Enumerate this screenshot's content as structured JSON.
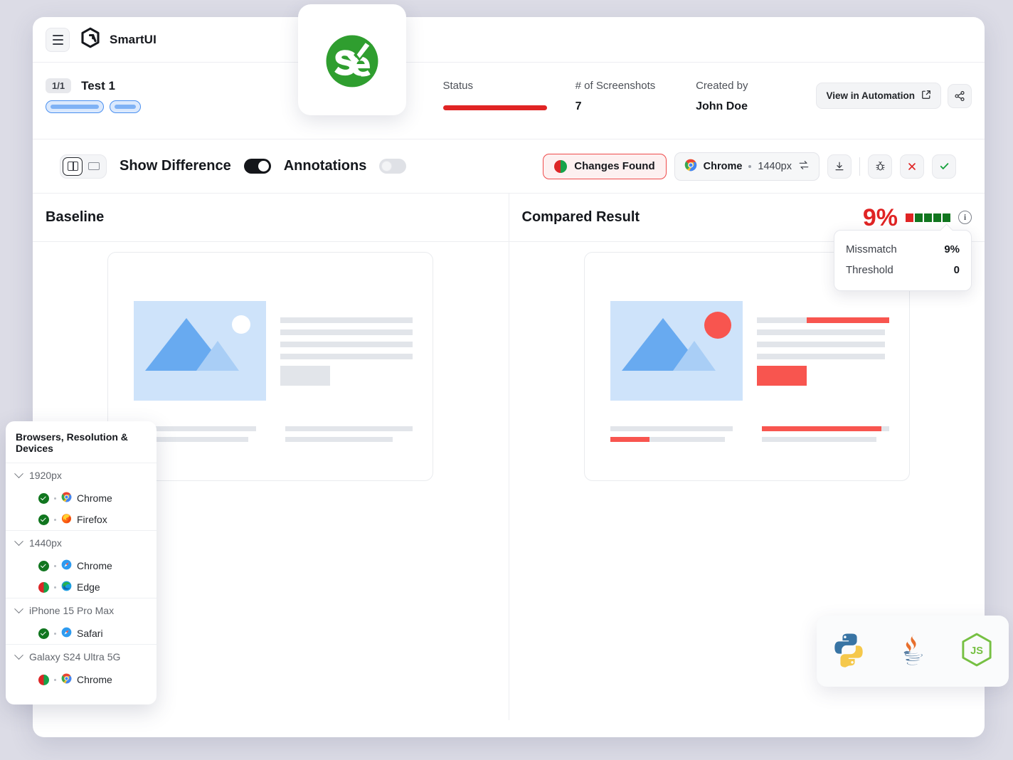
{
  "app": {
    "brand": "SmartUI",
    "menu_icon": "hamburger-icon",
    "logo_icon": "smartui-logo-icon"
  },
  "test": {
    "count_badge": "1/1",
    "title": "Test 1"
  },
  "meta": {
    "status_label": "Status",
    "status_color": "#e02424",
    "screenshots_label": "# of Screenshots",
    "screenshots_value": "7",
    "created_by_label": "Created by",
    "created_by_value": "John Doe",
    "view_automation_label": "View in Automation",
    "share_icon": "share-icon",
    "external-link-icon": "external-link-icon"
  },
  "toolbar": {
    "view_split_icon": "split-view-icon",
    "view_single_icon": "single-view-icon",
    "show_difference_label": "Show Difference",
    "show_difference_on": true,
    "annotations_label": "Annotations",
    "annotations_on": false,
    "changes_found_label": "Changes Found",
    "browser_name": "Chrome",
    "browser_resolution": "1440px",
    "swap_icon": "swap-arrows-icon",
    "download_icon": "download-icon",
    "bug_icon": "bug-icon",
    "reject_icon": "close-x-icon",
    "approve_icon": "check-icon"
  },
  "compare": {
    "baseline_label": "Baseline",
    "result_label": "Compared Result",
    "mismatch_percent": "9%",
    "segments": [
      "red",
      "green",
      "green",
      "green",
      "green"
    ],
    "info_icon": "info-icon",
    "tooltip": {
      "rows": [
        {
          "key": "Missmatch",
          "value": "9%"
        },
        {
          "key": "Threshold",
          "value": "0"
        }
      ]
    }
  },
  "browsers_panel": {
    "title": "Browsers, Resolution & Devices",
    "groups": [
      {
        "name": "1920px",
        "items": [
          {
            "label": "Chrome",
            "status": "pass",
            "browser_icon": "chrome-icon"
          },
          {
            "label": "Firefox",
            "status": "pass",
            "browser_icon": "firefox-icon"
          }
        ]
      },
      {
        "name": "1440px",
        "items": [
          {
            "label": "Chrome",
            "status": "pass",
            "browser_icon": "safari-icon"
          },
          {
            "label": "Edge",
            "status": "fail",
            "browser_icon": "edge-icon"
          }
        ]
      },
      {
        "name": "iPhone 15 Pro Max",
        "items": [
          {
            "label": "Safari",
            "status": "pass",
            "browser_icon": "safari-icon"
          }
        ]
      },
      {
        "name": "Galaxy S24 Ultra 5G",
        "items": [
          {
            "label": "Chrome",
            "status": "fail",
            "browser_icon": "chrome-icon"
          }
        ]
      }
    ]
  },
  "languages": {
    "items": [
      {
        "name": "python-icon"
      },
      {
        "name": "java-icon"
      },
      {
        "name": "nodejs-icon"
      }
    ]
  },
  "selenium_badge": {
    "icon": "selenium-logo-icon",
    "text": "Se"
  }
}
